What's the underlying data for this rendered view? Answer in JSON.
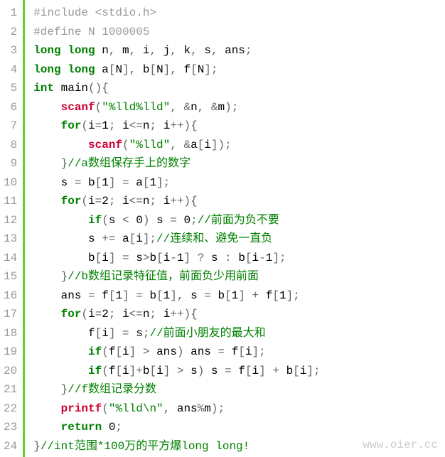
{
  "lineCount": 24,
  "watermark": "www.oier.cc",
  "code": [
    {
      "ind": 0,
      "tokens": [
        {
          "cls": "pp",
          "t": "#include <stdio.h>"
        }
      ]
    },
    {
      "ind": 0,
      "tokens": [
        {
          "cls": "pp",
          "t": "#define N 1000005"
        }
      ]
    },
    {
      "ind": 0,
      "tokens": [
        {
          "cls": "kw",
          "t": "long"
        },
        {
          "cls": "txt",
          "t": " "
        },
        {
          "cls": "kw",
          "t": "long"
        },
        {
          "cls": "txt",
          "t": " n"
        },
        {
          "cls": "pun",
          "t": ","
        },
        {
          "cls": "txt",
          "t": " m"
        },
        {
          "cls": "pun",
          "t": ","
        },
        {
          "cls": "txt",
          "t": " i"
        },
        {
          "cls": "pun",
          "t": ","
        },
        {
          "cls": "txt",
          "t": " j"
        },
        {
          "cls": "pun",
          "t": ","
        },
        {
          "cls": "txt",
          "t": " k"
        },
        {
          "cls": "pun",
          "t": ","
        },
        {
          "cls": "txt",
          "t": " s"
        },
        {
          "cls": "pun",
          "t": ","
        },
        {
          "cls": "txt",
          "t": " ans"
        },
        {
          "cls": "pun",
          "t": ";"
        }
      ]
    },
    {
      "ind": 0,
      "tokens": [
        {
          "cls": "kw",
          "t": "long"
        },
        {
          "cls": "txt",
          "t": " "
        },
        {
          "cls": "kw",
          "t": "long"
        },
        {
          "cls": "txt",
          "t": " a"
        },
        {
          "cls": "pun",
          "t": "["
        },
        {
          "cls": "txt",
          "t": "N"
        },
        {
          "cls": "pun",
          "t": "],"
        },
        {
          "cls": "txt",
          "t": " b"
        },
        {
          "cls": "pun",
          "t": "["
        },
        {
          "cls": "txt",
          "t": "N"
        },
        {
          "cls": "pun",
          "t": "],"
        },
        {
          "cls": "txt",
          "t": " f"
        },
        {
          "cls": "pun",
          "t": "["
        },
        {
          "cls": "txt",
          "t": "N"
        },
        {
          "cls": "pun",
          "t": "];"
        }
      ]
    },
    {
      "ind": 0,
      "tokens": [
        {
          "cls": "kw",
          "t": "int"
        },
        {
          "cls": "txt",
          "t": " main"
        },
        {
          "cls": "pun",
          "t": "(){"
        }
      ]
    },
    {
      "ind": 1,
      "tokens": [
        {
          "cls": "fn",
          "t": "scanf"
        },
        {
          "cls": "pun",
          "t": "("
        },
        {
          "cls": "str",
          "t": "\"%lld%lld\""
        },
        {
          "cls": "pun",
          "t": ", &"
        },
        {
          "cls": "txt",
          "t": "n"
        },
        {
          "cls": "pun",
          "t": ", &"
        },
        {
          "cls": "txt",
          "t": "m"
        },
        {
          "cls": "pun",
          "t": ");"
        }
      ]
    },
    {
      "ind": 1,
      "tokens": [
        {
          "cls": "kw",
          "t": "for"
        },
        {
          "cls": "pun",
          "t": "("
        },
        {
          "cls": "txt",
          "t": "i"
        },
        {
          "cls": "pun",
          "t": "="
        },
        {
          "cls": "txt",
          "t": "1"
        },
        {
          "cls": "pun",
          "t": ";"
        },
        {
          "cls": "txt",
          "t": " i"
        },
        {
          "cls": "pun",
          "t": "<="
        },
        {
          "cls": "txt",
          "t": "n"
        },
        {
          "cls": "pun",
          "t": ";"
        },
        {
          "cls": "txt",
          "t": " i"
        },
        {
          "cls": "pun",
          "t": "++){"
        }
      ]
    },
    {
      "ind": 2,
      "tokens": [
        {
          "cls": "fn",
          "t": "scanf"
        },
        {
          "cls": "pun",
          "t": "("
        },
        {
          "cls": "str",
          "t": "\"%lld\""
        },
        {
          "cls": "pun",
          "t": ", &"
        },
        {
          "cls": "txt",
          "t": "a"
        },
        {
          "cls": "pun",
          "t": "["
        },
        {
          "cls": "txt",
          "t": "i"
        },
        {
          "cls": "pun",
          "t": "]);"
        }
      ]
    },
    {
      "ind": 1,
      "tokens": [
        {
          "cls": "pun",
          "t": "}"
        },
        {
          "cls": "cmt",
          "t": "//a数组保存手上的数字"
        }
      ]
    },
    {
      "ind": 1,
      "tokens": [
        {
          "cls": "txt",
          "t": "s "
        },
        {
          "cls": "pun",
          "t": "="
        },
        {
          "cls": "txt",
          "t": " b"
        },
        {
          "cls": "pun",
          "t": "["
        },
        {
          "cls": "txt",
          "t": "1"
        },
        {
          "cls": "pun",
          "t": "] = "
        },
        {
          "cls": "txt",
          "t": "a"
        },
        {
          "cls": "pun",
          "t": "["
        },
        {
          "cls": "txt",
          "t": "1"
        },
        {
          "cls": "pun",
          "t": "];"
        }
      ]
    },
    {
      "ind": 1,
      "tokens": [
        {
          "cls": "kw",
          "t": "for"
        },
        {
          "cls": "pun",
          "t": "("
        },
        {
          "cls": "txt",
          "t": "i"
        },
        {
          "cls": "pun",
          "t": "="
        },
        {
          "cls": "txt",
          "t": "2"
        },
        {
          "cls": "pun",
          "t": ";"
        },
        {
          "cls": "txt",
          "t": " i"
        },
        {
          "cls": "pun",
          "t": "<="
        },
        {
          "cls": "txt",
          "t": "n"
        },
        {
          "cls": "pun",
          "t": ";"
        },
        {
          "cls": "txt",
          "t": " i"
        },
        {
          "cls": "pun",
          "t": "++){"
        }
      ]
    },
    {
      "ind": 2,
      "tokens": [
        {
          "cls": "kw",
          "t": "if"
        },
        {
          "cls": "pun",
          "t": "("
        },
        {
          "cls": "txt",
          "t": "s "
        },
        {
          "cls": "pun",
          "t": "<"
        },
        {
          "cls": "txt",
          "t": " 0"
        },
        {
          "cls": "pun",
          "t": ")"
        },
        {
          "cls": "txt",
          "t": " s "
        },
        {
          "cls": "pun",
          "t": "="
        },
        {
          "cls": "txt",
          "t": " 0"
        },
        {
          "cls": "pun",
          "t": ";"
        },
        {
          "cls": "cmt",
          "t": "//前面为负不要"
        }
      ]
    },
    {
      "ind": 2,
      "tokens": [
        {
          "cls": "txt",
          "t": "s "
        },
        {
          "cls": "pun",
          "t": "+="
        },
        {
          "cls": "txt",
          "t": " a"
        },
        {
          "cls": "pun",
          "t": "["
        },
        {
          "cls": "txt",
          "t": "i"
        },
        {
          "cls": "pun",
          "t": "];"
        },
        {
          "cls": "cmt",
          "t": "//连续和、避免一直负"
        }
      ]
    },
    {
      "ind": 2,
      "tokens": [
        {
          "cls": "txt",
          "t": "b"
        },
        {
          "cls": "pun",
          "t": "["
        },
        {
          "cls": "txt",
          "t": "i"
        },
        {
          "cls": "pun",
          "t": "] = "
        },
        {
          "cls": "txt",
          "t": "s"
        },
        {
          "cls": "pun",
          "t": ">"
        },
        {
          "cls": "txt",
          "t": "b"
        },
        {
          "cls": "pun",
          "t": "["
        },
        {
          "cls": "txt",
          "t": "i"
        },
        {
          "cls": "pun",
          "t": "-"
        },
        {
          "cls": "txt",
          "t": "1"
        },
        {
          "cls": "pun",
          "t": "] ? "
        },
        {
          "cls": "txt",
          "t": "s "
        },
        {
          "cls": "pun",
          "t": ": "
        },
        {
          "cls": "txt",
          "t": "b"
        },
        {
          "cls": "pun",
          "t": "["
        },
        {
          "cls": "txt",
          "t": "i"
        },
        {
          "cls": "pun",
          "t": "-"
        },
        {
          "cls": "txt",
          "t": "1"
        },
        {
          "cls": "pun",
          "t": "];"
        }
      ]
    },
    {
      "ind": 1,
      "tokens": [
        {
          "cls": "pun",
          "t": "}"
        },
        {
          "cls": "cmt",
          "t": "//b数组记录特征值，前面负少用前面"
        }
      ]
    },
    {
      "ind": 1,
      "tokens": [
        {
          "cls": "txt",
          "t": "ans "
        },
        {
          "cls": "pun",
          "t": "="
        },
        {
          "cls": "txt",
          "t": " f"
        },
        {
          "cls": "pun",
          "t": "["
        },
        {
          "cls": "txt",
          "t": "1"
        },
        {
          "cls": "pun",
          "t": "] = "
        },
        {
          "cls": "txt",
          "t": "b"
        },
        {
          "cls": "pun",
          "t": "["
        },
        {
          "cls": "txt",
          "t": "1"
        },
        {
          "cls": "pun",
          "t": "], "
        },
        {
          "cls": "txt",
          "t": "s "
        },
        {
          "cls": "pun",
          "t": "="
        },
        {
          "cls": "txt",
          "t": " b"
        },
        {
          "cls": "pun",
          "t": "["
        },
        {
          "cls": "txt",
          "t": "1"
        },
        {
          "cls": "pun",
          "t": "] + "
        },
        {
          "cls": "txt",
          "t": "f"
        },
        {
          "cls": "pun",
          "t": "["
        },
        {
          "cls": "txt",
          "t": "1"
        },
        {
          "cls": "pun",
          "t": "];"
        }
      ]
    },
    {
      "ind": 1,
      "tokens": [
        {
          "cls": "kw",
          "t": "for"
        },
        {
          "cls": "pun",
          "t": "("
        },
        {
          "cls": "txt",
          "t": "i"
        },
        {
          "cls": "pun",
          "t": "="
        },
        {
          "cls": "txt",
          "t": "2"
        },
        {
          "cls": "pun",
          "t": ";"
        },
        {
          "cls": "txt",
          "t": " i"
        },
        {
          "cls": "pun",
          "t": "<="
        },
        {
          "cls": "txt",
          "t": "n"
        },
        {
          "cls": "pun",
          "t": ";"
        },
        {
          "cls": "txt",
          "t": " i"
        },
        {
          "cls": "pun",
          "t": "++){"
        }
      ]
    },
    {
      "ind": 2,
      "tokens": [
        {
          "cls": "txt",
          "t": "f"
        },
        {
          "cls": "pun",
          "t": "["
        },
        {
          "cls": "txt",
          "t": "i"
        },
        {
          "cls": "pun",
          "t": "] = "
        },
        {
          "cls": "txt",
          "t": "s"
        },
        {
          "cls": "pun",
          "t": ";"
        },
        {
          "cls": "cmt",
          "t": "//前面小朋友的最大和"
        }
      ]
    },
    {
      "ind": 2,
      "tokens": [
        {
          "cls": "kw",
          "t": "if"
        },
        {
          "cls": "pun",
          "t": "("
        },
        {
          "cls": "txt",
          "t": "f"
        },
        {
          "cls": "pun",
          "t": "["
        },
        {
          "cls": "txt",
          "t": "i"
        },
        {
          "cls": "pun",
          "t": "] > "
        },
        {
          "cls": "txt",
          "t": "ans"
        },
        {
          "cls": "pun",
          "t": ")"
        },
        {
          "cls": "txt",
          "t": " ans "
        },
        {
          "cls": "pun",
          "t": "="
        },
        {
          "cls": "txt",
          "t": " f"
        },
        {
          "cls": "pun",
          "t": "["
        },
        {
          "cls": "txt",
          "t": "i"
        },
        {
          "cls": "pun",
          "t": "];"
        }
      ]
    },
    {
      "ind": 2,
      "tokens": [
        {
          "cls": "kw",
          "t": "if"
        },
        {
          "cls": "pun",
          "t": "("
        },
        {
          "cls": "txt",
          "t": "f"
        },
        {
          "cls": "pun",
          "t": "["
        },
        {
          "cls": "txt",
          "t": "i"
        },
        {
          "cls": "pun",
          "t": "]+"
        },
        {
          "cls": "txt",
          "t": "b"
        },
        {
          "cls": "pun",
          "t": "["
        },
        {
          "cls": "txt",
          "t": "i"
        },
        {
          "cls": "pun",
          "t": "] > "
        },
        {
          "cls": "txt",
          "t": "s"
        },
        {
          "cls": "pun",
          "t": ")"
        },
        {
          "cls": "txt",
          "t": " s "
        },
        {
          "cls": "pun",
          "t": "="
        },
        {
          "cls": "txt",
          "t": " f"
        },
        {
          "cls": "pun",
          "t": "["
        },
        {
          "cls": "txt",
          "t": "i"
        },
        {
          "cls": "pun",
          "t": "] + "
        },
        {
          "cls": "txt",
          "t": "b"
        },
        {
          "cls": "pun",
          "t": "["
        },
        {
          "cls": "txt",
          "t": "i"
        },
        {
          "cls": "pun",
          "t": "];"
        }
      ]
    },
    {
      "ind": 1,
      "tokens": [
        {
          "cls": "pun",
          "t": "}"
        },
        {
          "cls": "cmt",
          "t": "//f数组记录分数"
        }
      ]
    },
    {
      "ind": 1,
      "tokens": [
        {
          "cls": "fn",
          "t": "printf"
        },
        {
          "cls": "pun",
          "t": "("
        },
        {
          "cls": "str",
          "t": "\"%lld\\n\""
        },
        {
          "cls": "pun",
          "t": ", "
        },
        {
          "cls": "txt",
          "t": "ans"
        },
        {
          "cls": "pun",
          "t": "%"
        },
        {
          "cls": "txt",
          "t": "m"
        },
        {
          "cls": "pun",
          "t": ");"
        }
      ]
    },
    {
      "ind": 1,
      "tokens": [
        {
          "cls": "kw",
          "t": "return"
        },
        {
          "cls": "txt",
          "t": " 0"
        },
        {
          "cls": "pun",
          "t": ";"
        }
      ]
    },
    {
      "ind": 0,
      "tokens": [
        {
          "cls": "pun",
          "t": "}"
        },
        {
          "cls": "cmt",
          "t": "//int范围*100万的平方爆long long!"
        }
      ]
    }
  ]
}
